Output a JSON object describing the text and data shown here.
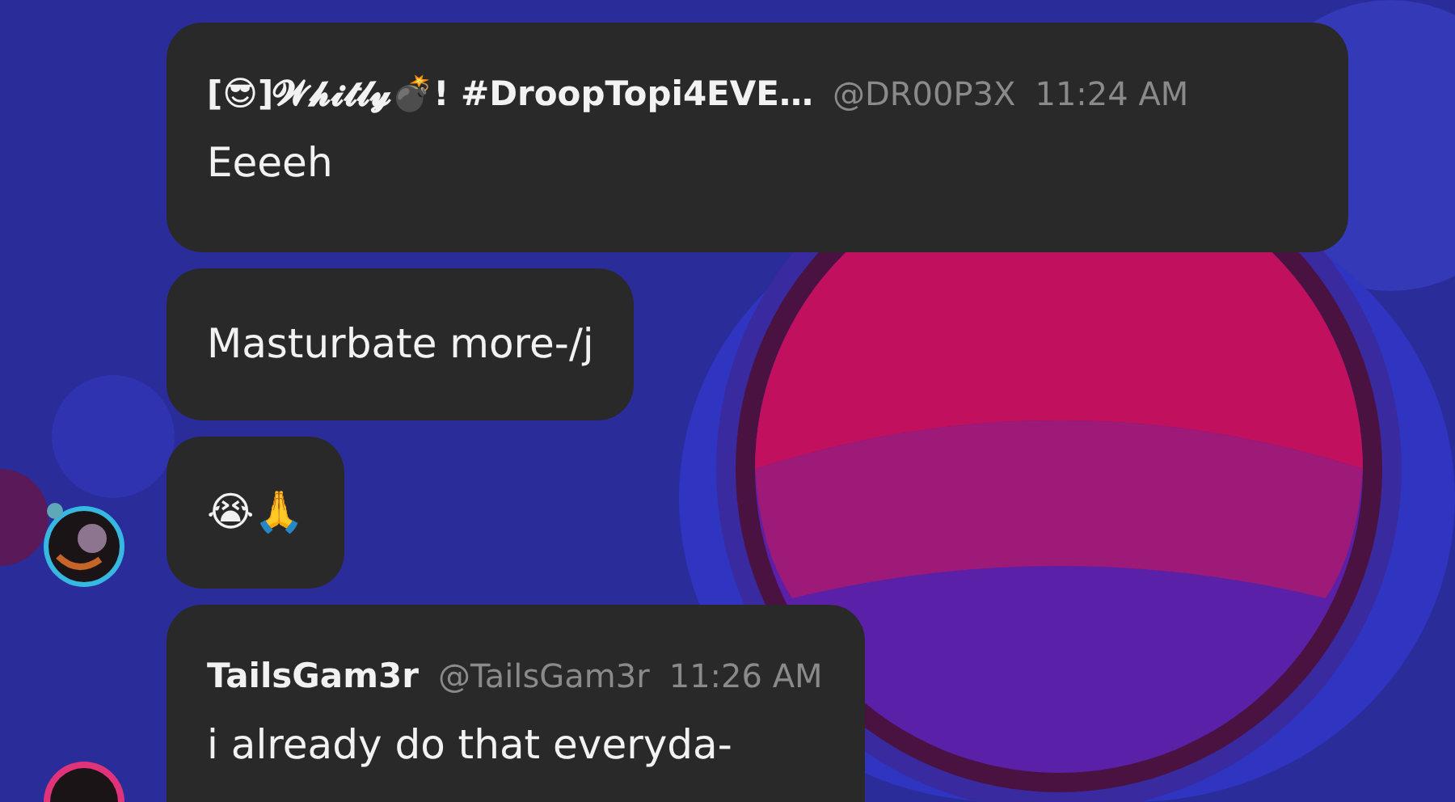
{
  "messages": [
    {
      "kind": "header",
      "author": "[😎]𝓦𝓱𝓲𝓽𝓵𝔂💣! #DroopTopi4EVE…",
      "handle": "@DR00P3X",
      "time": "11:24 AM",
      "text": "Eeeeh",
      "avatar": false
    },
    {
      "kind": "plain",
      "text": "Masturbate more-/j",
      "avatar": false
    },
    {
      "kind": "plain",
      "text": "😭🙏",
      "avatar": true
    },
    {
      "kind": "header",
      "author": "TailsGam3r",
      "handle": "@TailsGam3r",
      "time": "11:26 AM",
      "text": "i already do that everyda-",
      "avatar": true
    }
  ]
}
